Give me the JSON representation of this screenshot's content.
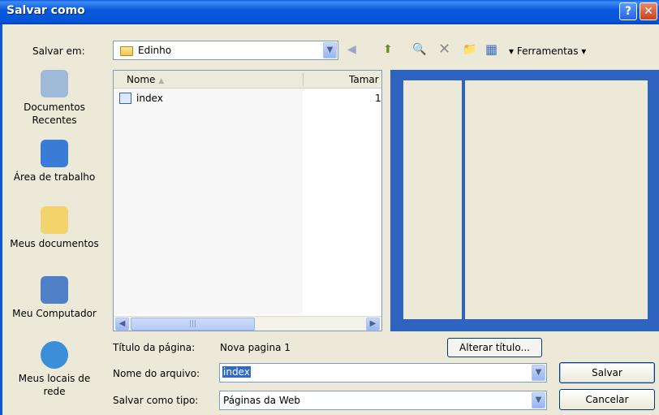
{
  "window": {
    "title": "Salvar como",
    "help": "?",
    "close": "✕"
  },
  "save_in": {
    "label": "Salvar em:",
    "value": "Edinho"
  },
  "toolbar": {
    "back": "◀",
    "up": "⬆",
    "search": "🔍",
    "delete": "✕",
    "new_folder": "📁",
    "views": "▦",
    "tools": "▾ Ferramentas ▾"
  },
  "places": [
    {
      "label": "Documentos Recentes",
      "icon": "recent-documents-icon",
      "color": "#9fb9d9"
    },
    {
      "label": "Área de trabalho",
      "icon": "desktop-icon",
      "color": "#3a7bd5"
    },
    {
      "label": "Meus documentos",
      "icon": "my-documents-icon",
      "color": "#f3d36b"
    },
    {
      "label": "Meu Computador",
      "icon": "my-computer-icon",
      "color": "#4f7fc7"
    },
    {
      "label": "Meus locais de rede",
      "icon": "network-places-icon",
      "color": "#3b8fd8"
    }
  ],
  "list": {
    "headers": {
      "name": "Nome",
      "size": "Tamar"
    },
    "sort_indicator": "▲",
    "rows": [
      {
        "name": "index",
        "size": "1"
      }
    ],
    "scroll_left": "◀",
    "scroll_right": "▶",
    "thumb_grip": "|||"
  },
  "page_title": {
    "label": "Título da página:",
    "value": "Nova pagina 1",
    "change_button": "Alterar título..."
  },
  "file_name": {
    "label": "Nome do arquivo:",
    "value": "index"
  },
  "file_type": {
    "label": "Salvar como tipo:",
    "value": "Páginas da Web"
  },
  "buttons": {
    "save": "Salvar",
    "cancel": "Cancelar"
  },
  "colors": {
    "titlebar": "#0654d8",
    "preview_border": "#2e64c0",
    "selection": "#316ac5"
  }
}
